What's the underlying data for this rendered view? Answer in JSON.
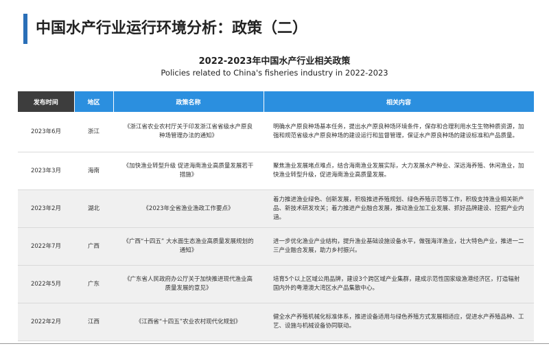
{
  "header": {
    "title": "中国水产行业运行环境分析：政策（二）"
  },
  "table": {
    "title": "2022-2023年中国水产行业相关政策",
    "subtitle": "Policies related to China's fisheries industry in 2022-2023",
    "columns": [
      "发布时间",
      "地区",
      "政策名称",
      "相关内容"
    ],
    "rows": [
      {
        "date": "2023年6月",
        "region": "浙江",
        "name": "《浙江省农业农村厅关于印发浙江省省级水产原良种场管理办法的通知》",
        "content": "明确水产原良种场基本任务，提出水产原良种场环境条件，保存和合理利用水生生物种质资源，加强和规范省级水产原良种场的建设运行和监督管理，保证水产原良种场的建设标准和产品质量。"
      },
      {
        "date": "2023年3月",
        "region": "海南",
        "name": "《加快渔业转型升级 促进海南渔业高质量发展若干措施》",
        "content": "聚焦渔业发展堵点难点，结合海南渔业发展实际，大力发展水产种业、深远海养殖、休闲渔业，加快渔业转型升级，促进海南渔业高质量发展。"
      },
      {
        "date": "2023年2月",
        "region": "湖北",
        "name": "《2023年全省渔业渔政工作要点》",
        "content": "着力推进渔业绿色、创新发展，积极推进养殖规划、绿色养殖示范等工作，积极支持渔业相关新产品、新技术研发攻关；着力推进产业融合发展，推动渔业加工业发展、抓好品牌建设、挖掘产业内涵。"
      },
      {
        "date": "2022年7月",
        "region": "广西",
        "name": "《广西“十四五” 大水面生态渔业高质量发展规划的通知》",
        "content": "进一步优化渔业产业结构，提升渔业基础设施设备水平，做强海洋渔业，壮大特色产业，推进一二三产业融合发展，助力乡村振兴。"
      },
      {
        "date": "2022年5月",
        "region": "广东",
        "name": "《广东省人民政府办公厅关于加快推进现代渔业高质量发展的意见》",
        "content": "培育5个以上区域公用品牌，建设3个跨区域产业集群，建成示范性国家级渔港经济区，打造辐射国内外的粤港澳大湾区水产品集散中心。"
      },
      {
        "date": "2022年2月",
        "region": "江西",
        "name": "《江西省“十四五”农业农村现代化规划》",
        "content": "健全水产养殖机械化标准体系，推进设备适用与绿色养殖方式发展相适应，促进水产养殖品种、工艺、设施与机械设备协同联动。"
      }
    ]
  },
  "colors": {
    "accent": "#2a6fb8",
    "header_dark": "#3d3d3d",
    "header_blue": "#2b8fdf",
    "row_shade": "#f0f0f0"
  }
}
